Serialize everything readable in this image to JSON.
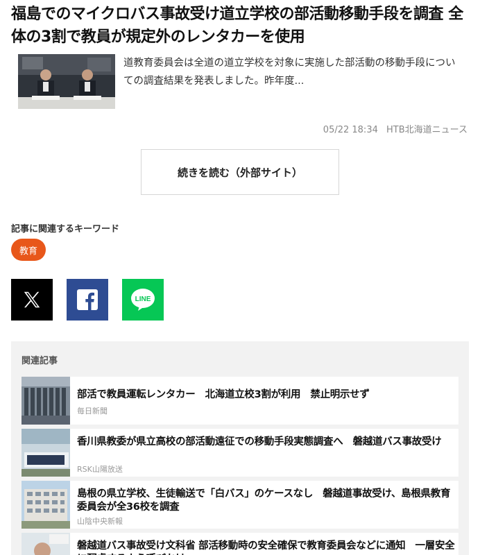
{
  "article": {
    "title": "福島でのマイクロバス事故受け道立学校の部活動移動手段を調査 全体の3割で教員が規定外のレンタカーを使用",
    "summary": "道教育委員会は全道の道立学校を対象に実施した部活動の移動手段についての調査結果を発表しました。昨年度...",
    "date": "05/22 18:34",
    "source": "HTB北海道ニュース",
    "read_more_label": "続きを読む（外部サイト）"
  },
  "keywords": {
    "heading": "記事に関連するキーワード",
    "tags": [
      "教育"
    ]
  },
  "share": {
    "x_icon": "x-logo-icon",
    "facebook_icon": "facebook-logo-icon",
    "line_icon": "line-logo-icon",
    "line_label": "LINE",
    "colors": {
      "x": "#000000",
      "facebook": "#2e4c93",
      "line": "#06c755",
      "tag": "#e8571a"
    }
  },
  "related": {
    "heading": "関連記事",
    "items": [
      {
        "title": "部活で教員運転レンタカー　北海道立校3割が利用　禁止明示せず",
        "source": "毎日新聞"
      },
      {
        "title": "香川県教委が県立高校の部活動遠征での移動手段実態調査へ　磐越道バス事故受け",
        "source": "RSK山陽放送"
      },
      {
        "title": "島根の県立学校、生徒輸送で「白バス」のケースなし　磐越道事故受け、島根県教育委員会が全36校を調査",
        "source": "山陰中央新報"
      },
      {
        "title": "磐越道バス事故受け文科省 部活移動時の安全確保で教育委員会などに通知　一層安全に配慮するよう呼びかけ",
        "source": ""
      }
    ]
  }
}
